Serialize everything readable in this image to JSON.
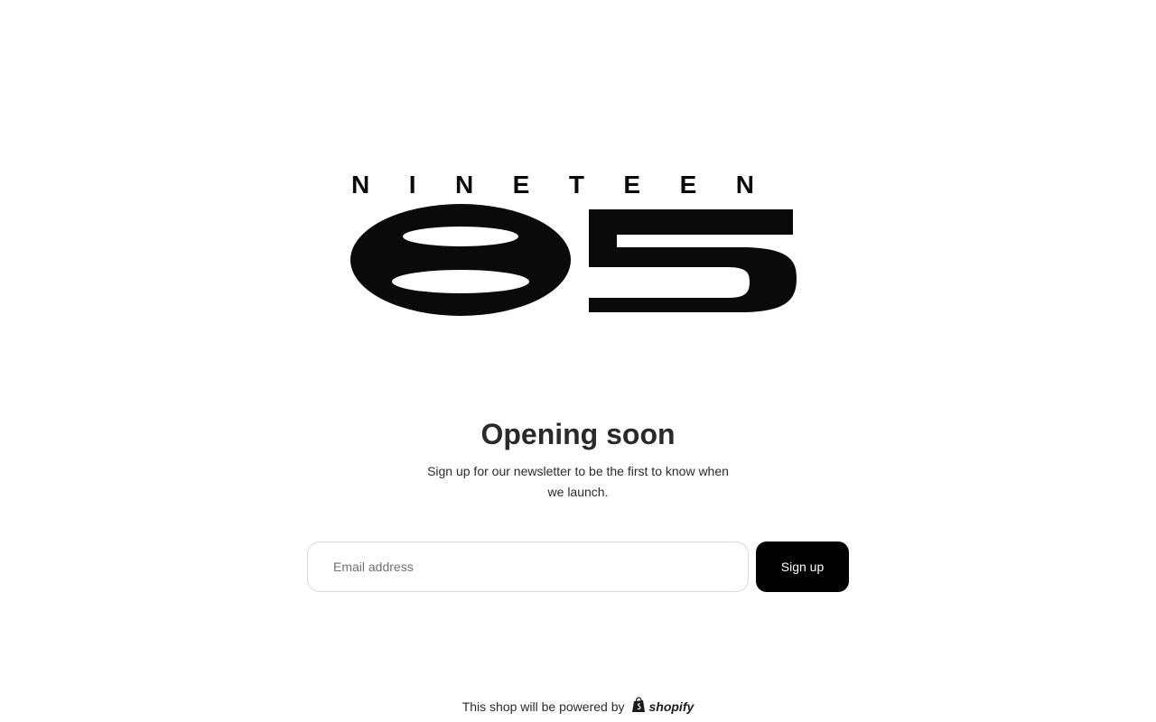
{
  "brand": {
    "logo_top_text": "NINETEEN",
    "logo_number": "85"
  },
  "main": {
    "heading": "Opening soon",
    "subtext": "Sign up for our newsletter to be the first to know when we launch."
  },
  "signup": {
    "email_placeholder": "Email address",
    "email_value": "",
    "button_label": "Sign up"
  },
  "footer": {
    "text": "This shop will be powered by",
    "shopify_label": "shopify",
    "shopify_icon": "shopify-bag-icon"
  },
  "colors": {
    "background": "#ffffff",
    "button_bg": "#000000",
    "button_text": "#ffffff",
    "logo": "#0a0a0a"
  }
}
